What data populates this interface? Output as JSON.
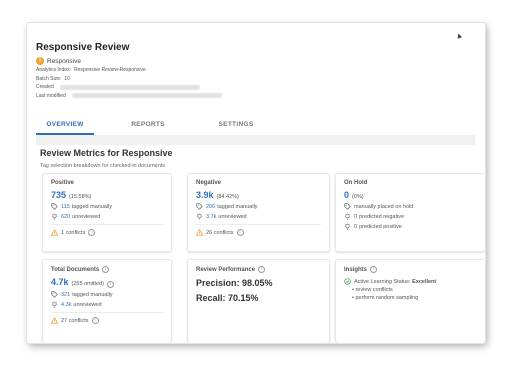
{
  "header": {
    "title": "Responsive Review",
    "status_icon": "!",
    "status_label": "Responsive",
    "analytics_index_label": "Analytics Index:",
    "analytics_index_value": "Responsive Review-Responsive",
    "batch_size_label": "Batch Size:",
    "batch_size_value": "10",
    "created_label": "Created",
    "last_modified_label": "Last modified",
    "menu_glyph": "▲"
  },
  "tabs": [
    "OVERVIEW",
    "REPORTS",
    "SETTINGS"
  ],
  "section": {
    "title": "Review Metrics for Responsive",
    "subtitle": "Tag selection breakdown for checked-in documents"
  },
  "cards": {
    "positive": {
      "title": "Positive",
      "big": "735",
      "pct": "(15.58%)",
      "tagged_num": "115",
      "tagged_text": "tagged manually",
      "unreviewed_num": "620",
      "unreviewed_text": "unreviewed",
      "conflicts": "1 conflicts"
    },
    "negative": {
      "title": "Negative",
      "big": "3.9k",
      "pct": "(84.42%)",
      "tagged_num": "206",
      "tagged_text": "tagged manually",
      "unreviewed_num": "3.7k",
      "unreviewed_text": "unreviewed",
      "conflicts": "26 conflicts"
    },
    "on_hold": {
      "title": "On Hold",
      "big": "0",
      "pct": "(0%)",
      "manual_text": "manually placed on hold",
      "pred_neg_num": "0",
      "pred_neg_text": "predicted negative",
      "pred_pos_num": "0",
      "pred_pos_text": "predicted positive"
    },
    "total": {
      "title": "Total Documents",
      "big": "4.7k",
      "pct": "(255 omitted)",
      "tagged_num": "321",
      "tagged_text": "tagged manually",
      "unreviewed_num": "4.3k",
      "unreviewed_text": "unreviewed",
      "conflicts": "27 conflicts"
    },
    "performance": {
      "title": "Review Performance",
      "precision": "Precision: 98.05%",
      "recall": "Recall: 70.15%"
    },
    "insights": {
      "title": "Insights",
      "status_label": "Active Learning Status:",
      "status_value": "Excellent",
      "bullets": [
        "review conflicts",
        "perform random sampling"
      ]
    }
  },
  "colors": {
    "accent": "#2f6fb7",
    "warning": "#f0a030",
    "success": "#3aa04a"
  }
}
